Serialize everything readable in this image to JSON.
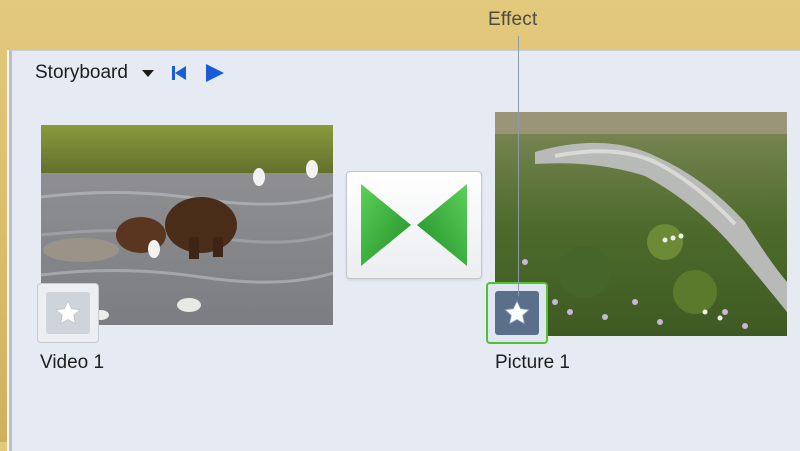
{
  "callout": {
    "label": "Effect"
  },
  "toolbar": {
    "title": "Storyboard"
  },
  "clips": [
    {
      "label": "Video 1"
    },
    {
      "label": "Picture 1"
    }
  ],
  "icons": {
    "dropdown": "chevron-down-icon",
    "rewind": "skip-to-start-icon",
    "play": "play-icon",
    "transition": "bowtie-transition-icon",
    "effect": "star-icon"
  },
  "colors": {
    "accent_blue": "#1a5bd8",
    "transition_green": "#2fa12f",
    "effect_highlight": "#52c234"
  }
}
